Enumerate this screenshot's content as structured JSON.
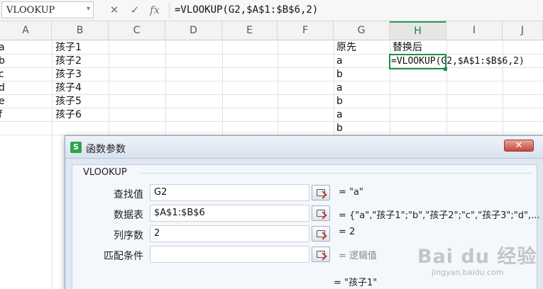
{
  "formula_bar": {
    "name_box": "VLOOKUP",
    "cancel_icon": "✕",
    "enter_icon": "✓",
    "fx_label": "fx",
    "formula": "=VLOOKUP(G2,$A$1:$B$6,2)"
  },
  "columns": [
    "A",
    "B",
    "C",
    "D",
    "E",
    "F",
    "G",
    "H",
    "I",
    "J"
  ],
  "active_column": "H",
  "cells": {
    "A": [
      "a",
      "b",
      "c",
      "d",
      "e",
      "f"
    ],
    "B": [
      "孩子1",
      "孩子2",
      "孩子3",
      "孩子4",
      "孩子5",
      "孩子6"
    ],
    "G": [
      "原先",
      "a",
      "b",
      "a",
      "b",
      "a",
      "b"
    ],
    "H1": "替换后",
    "H2": "=VLOOKUP(G2,$A$1:$B$6,2)"
  },
  "dialog": {
    "title": "函数参数",
    "close": "✕",
    "function_name": "VLOOKUP",
    "params": [
      {
        "label": "查找值",
        "value": "G2",
        "result": "= \"a\""
      },
      {
        "label": "数据表",
        "value": "$A$1:$B$6",
        "result": "= {\"a\",\"孩子1\";\"b\",\"孩子2\";\"c\",\"孩子3\";\"d\",..."
      },
      {
        "label": "列序数",
        "value": "2",
        "result": "= 2"
      },
      {
        "label": "匹配条件",
        "value": "",
        "result": "= 逻辑值"
      }
    ],
    "final_result": "= \"孩子1\""
  },
  "watermark": {
    "logo": "Bai du 经验",
    "url": "jingyan.baidu.com"
  }
}
